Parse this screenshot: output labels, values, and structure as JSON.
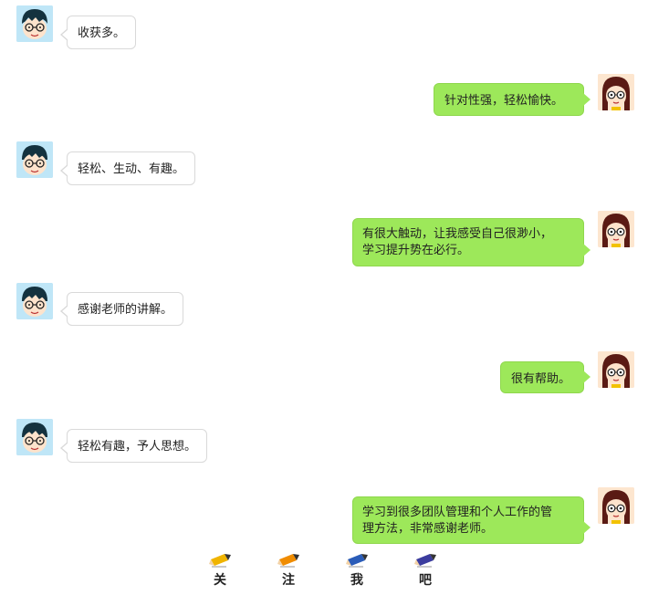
{
  "messages": [
    {
      "side": "left",
      "text": "收获多。"
    },
    {
      "side": "right",
      "text": "针对性强，轻松愉快。"
    },
    {
      "side": "left",
      "text": "轻松、生动、有趣。"
    },
    {
      "side": "right",
      "lines": [
        "有很大触动，让我感受自己很渺小，",
        "学习提升势在必行。"
      ]
    },
    {
      "side": "left",
      "text": "感谢老师的讲解。"
    },
    {
      "side": "right",
      "text": "很有帮助。"
    },
    {
      "side": "left",
      "text": "轻松有趣，予人思想。"
    },
    {
      "side": "right",
      "lines": [
        "学习到很多团队管理和个人工作的管",
        "理方法，非常感谢老师。"
      ]
    }
  ],
  "follow": {
    "chars": [
      "关",
      "注",
      "我",
      "吧"
    ],
    "pencil_colors": [
      "#f0b400",
      "#f08c00",
      "#2a5cb8",
      "#3b3c9e"
    ]
  },
  "colors": {
    "left_bubble": "#ffffff",
    "right_bubble": "#9de85a",
    "boy_avatar_bg": "#bfe6f7",
    "girl_avatar_bg": "#fde6cf"
  }
}
